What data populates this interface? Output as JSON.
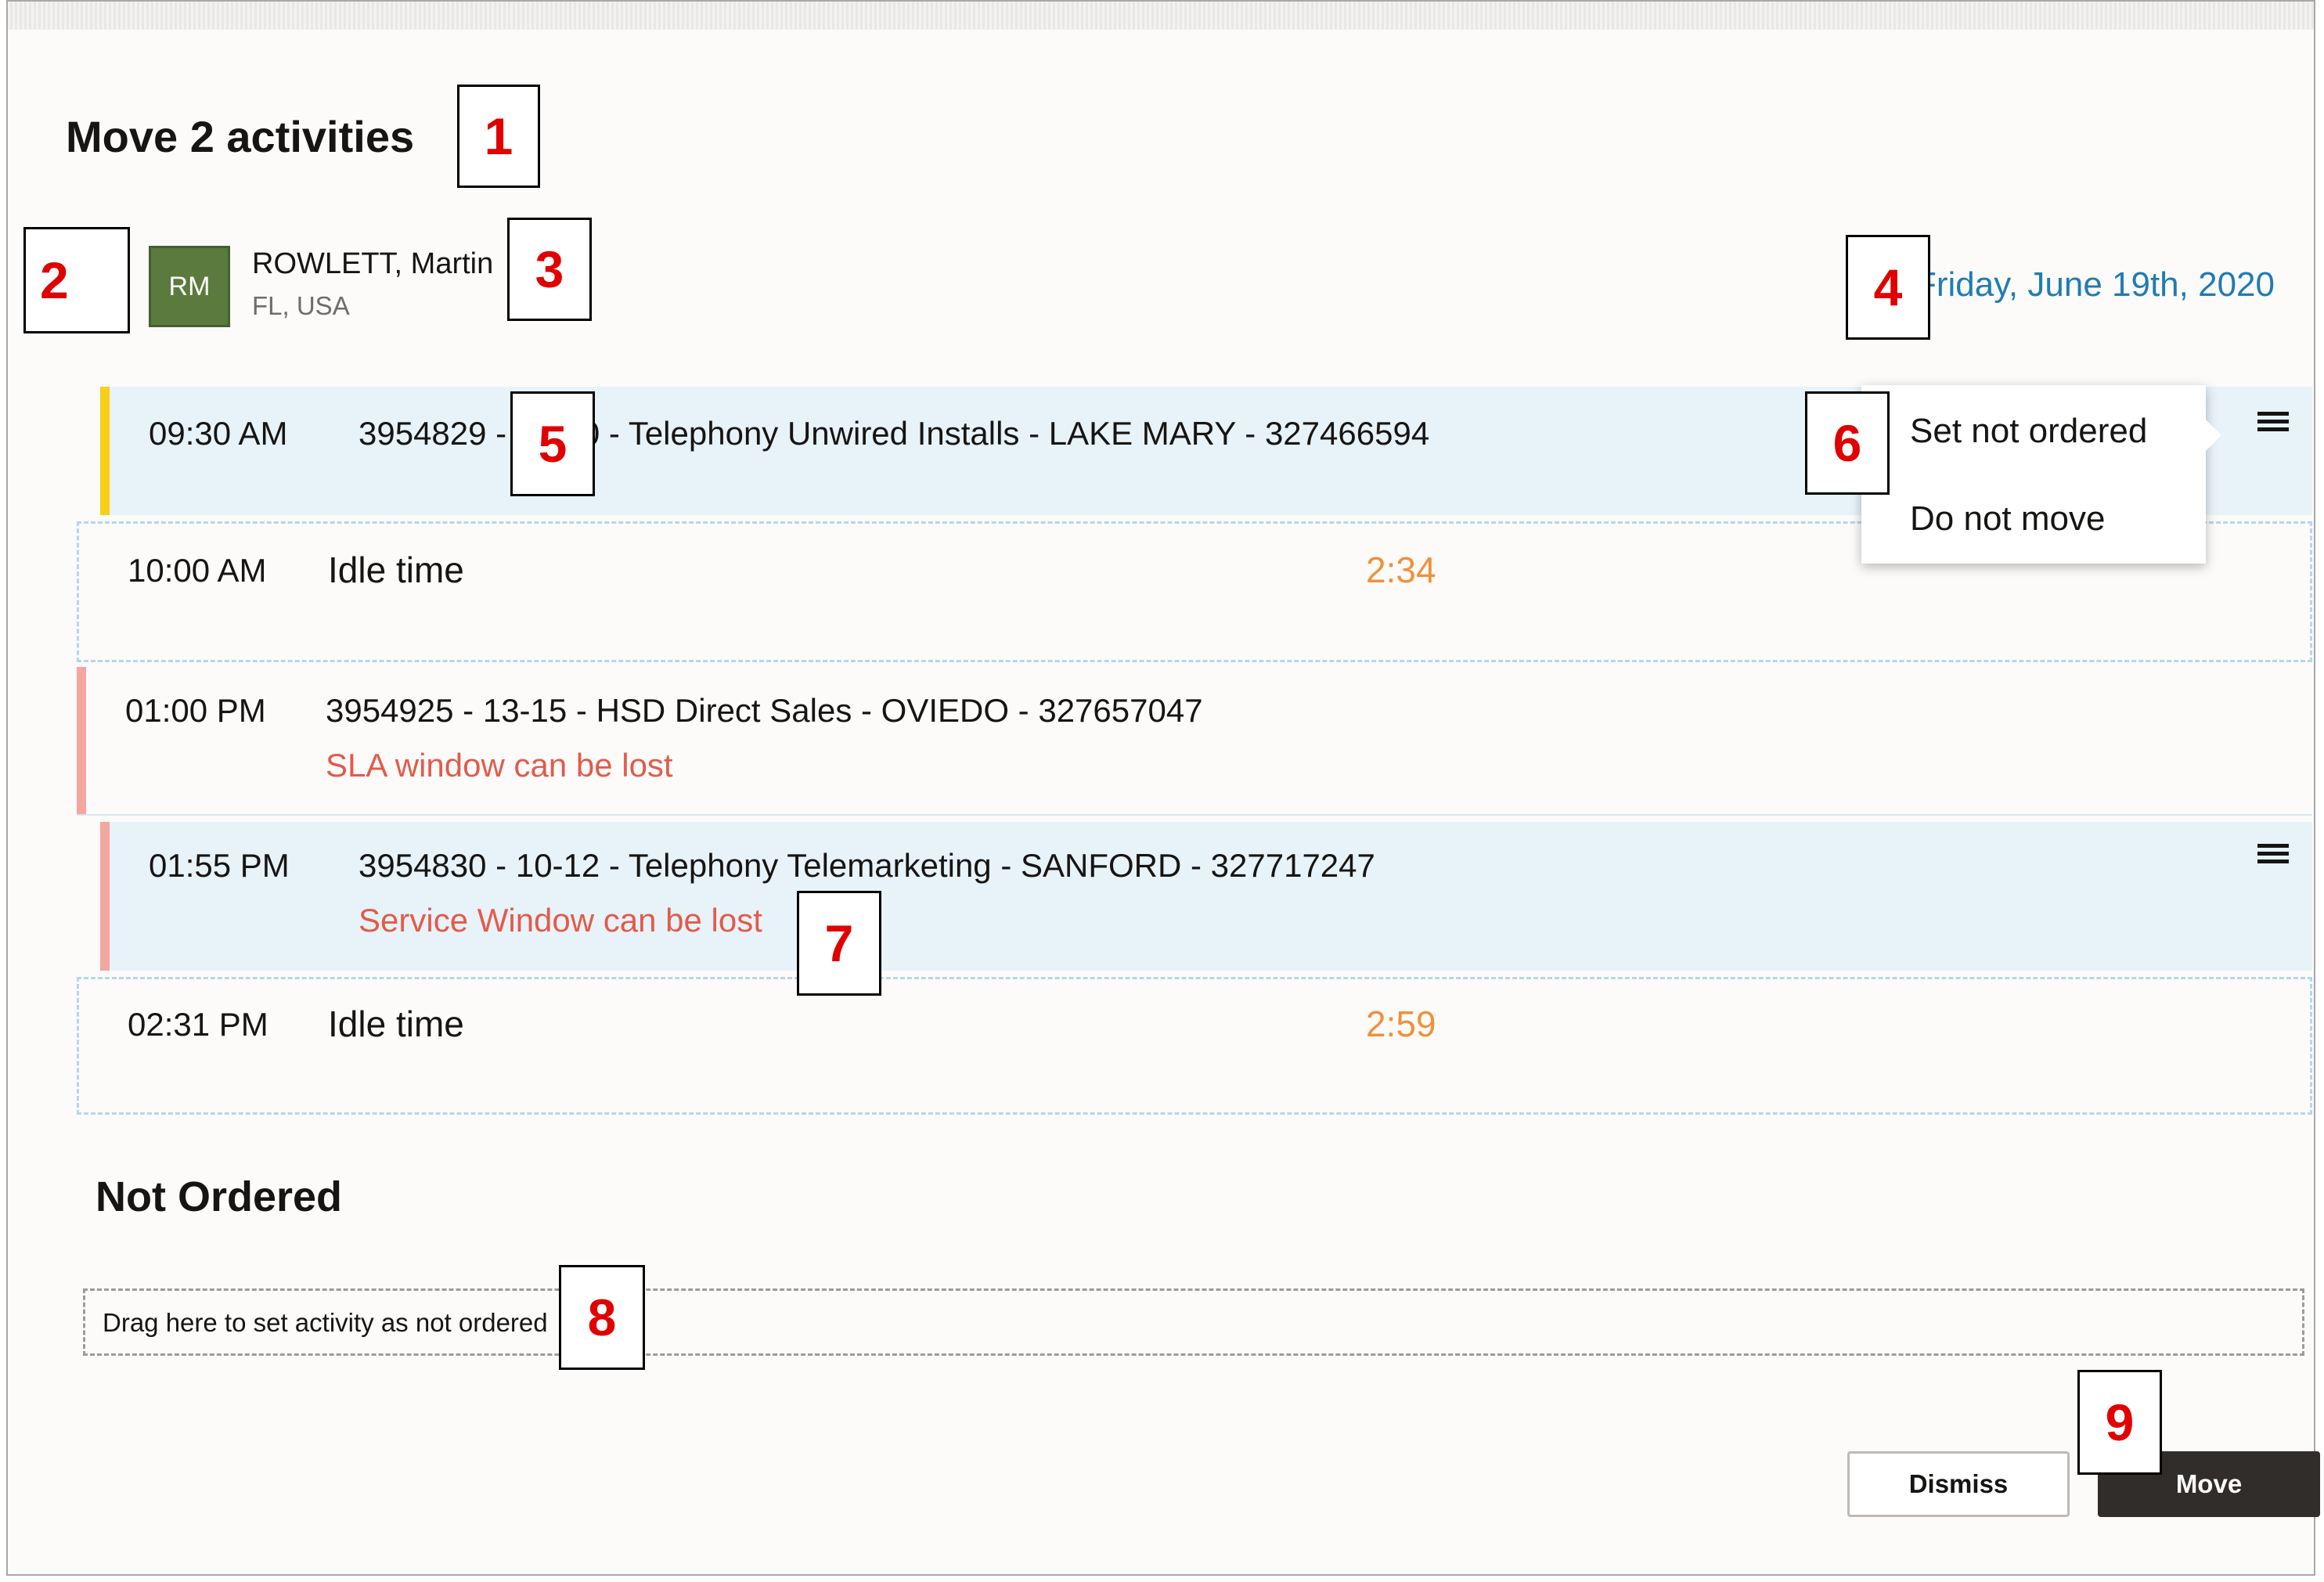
{
  "dialog": {
    "title": "Move 2 activities"
  },
  "resource": {
    "back_icon": "chevron-left-icon",
    "avatar_initials": "RM",
    "avatar_color": "#5b7a3e",
    "name": "ROWLETT, Martin",
    "location": "FL, USA",
    "date": "Friday, June 19th, 2020"
  },
  "route": [
    {
      "type": "activity",
      "time": "09:30 AM",
      "desc": "3954829 - 10-10 - Telephony Unwired Installs - LAKE MARY - 327466594",
      "status_color": "#f5cf1a",
      "moving": true,
      "menu_icon": "hamburger-menu-icon"
    },
    {
      "type": "idle",
      "time": "10:00 AM",
      "label": "Idle time",
      "duration": "2:34"
    },
    {
      "type": "activity",
      "time": "01:00 PM",
      "desc": "3954925 - 13-15 - HSD Direct Sales - OVIEDO - 327657047",
      "warning": "SLA window can be lost",
      "status_color": "#f4a6a0",
      "moving": false
    },
    {
      "type": "activity",
      "time": "01:55 PM",
      "desc": "3954830 - 10-12 - Telephony Telemarketing - SANFORD - 327717247",
      "warning": "Service Window can be lost",
      "status_color": "#f4a6a0",
      "moving": true,
      "menu_icon": "hamburger-menu-icon"
    },
    {
      "type": "idle",
      "time": "02:31 PM",
      "label": "Idle time",
      "duration": "2:59"
    }
  ],
  "context_menu": {
    "items": [
      "Set not ordered",
      "Do not move"
    ]
  },
  "not_ordered": {
    "title": "Not Ordered",
    "dropzone_text": "Drag here to set activity as not ordered"
  },
  "buttons": {
    "dismiss": "Dismiss",
    "move": "Move"
  },
  "callouts": [
    "1",
    "2",
    "3",
    "4",
    "5",
    "6",
    "7",
    "8",
    "9"
  ],
  "colors": {
    "accent_link": "#1f7cb3",
    "warning_text": "#e25b4a",
    "idle_duration": "#f0913a",
    "moving_row_bg": "#e8f2f9",
    "primary_button": "#312d2a"
  }
}
